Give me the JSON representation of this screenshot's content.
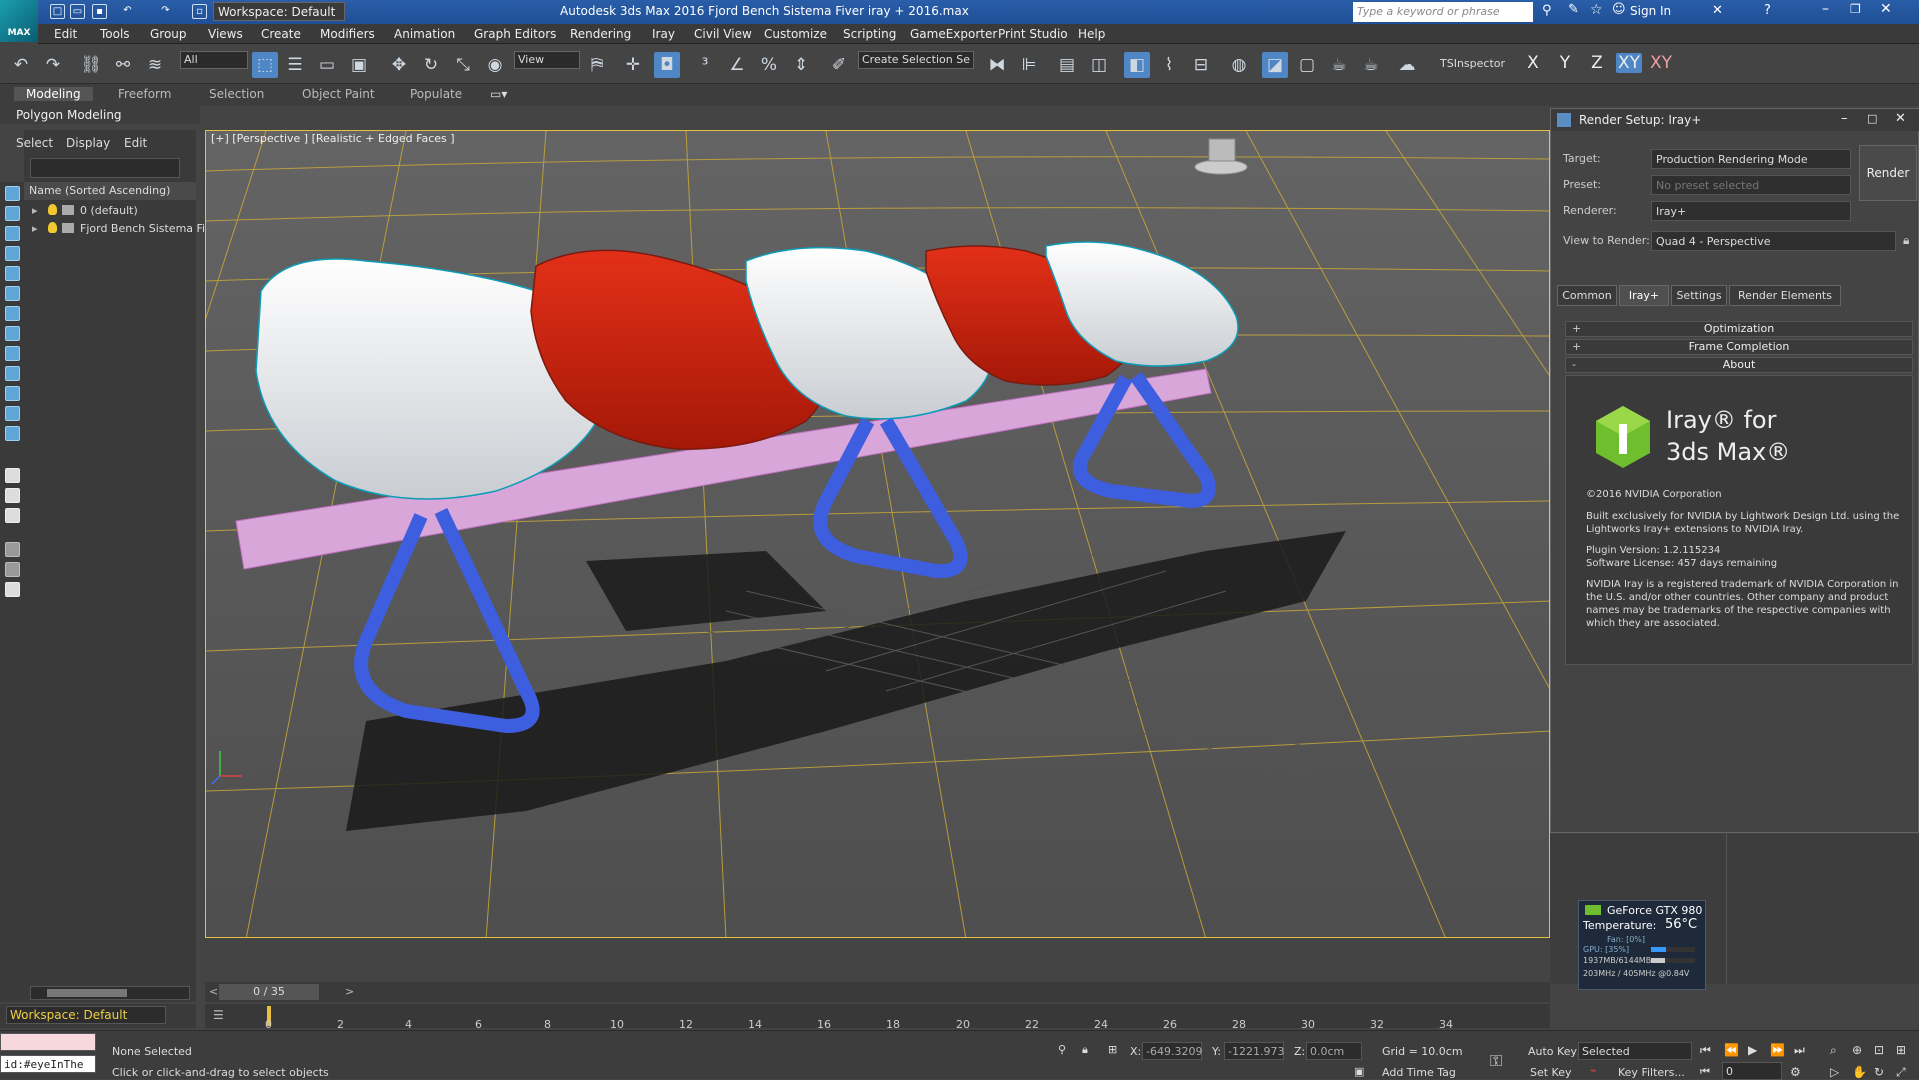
{
  "titlebar": {
    "app_title": "Autodesk 3ds Max 2016    Fjord Bench Sistema Fiver iray + 2016.max",
    "workspace": "Workspace: Default",
    "search_placeholder": "Type a keyword or phrase",
    "sign_in": "Sign In",
    "logo_text": "MAX"
  },
  "menubar": [
    "Edit",
    "Tools",
    "Group",
    "Views",
    "Create",
    "Modifiers",
    "Animation",
    "Graph Editors",
    "Rendering",
    "Iray",
    "Civil View",
    "Customize",
    "Scripting",
    "GameExporter",
    "Print Studio",
    "Help"
  ],
  "toolbar": {
    "selection_filter": "All",
    "reference_coord": "View",
    "named_selection": "Create Selection Se",
    "ts_inspector": "TSInspector",
    "axes": [
      "X",
      "Y",
      "Z",
      "XY",
      "XY"
    ]
  },
  "ribbon": {
    "tabs": [
      "Modeling",
      "Freeform",
      "Selection",
      "Object Paint",
      "Populate"
    ],
    "panel": "Polygon Modeling"
  },
  "explorer": {
    "menu": [
      "Select",
      "Display",
      "Edit"
    ],
    "column_header": "Name (Sorted Ascending)",
    "rows": [
      "0 (default)",
      "Fjord Bench Sistema Fiv"
    ],
    "workspace": "Workspace: Default"
  },
  "viewport": {
    "label": "[+] [Perspective ] [Realistic + Edged Faces ]"
  },
  "render_setup": {
    "title": "Render Setup: Iray+",
    "target_label": "Target:",
    "target_value": "Production Rendering Mode",
    "preset_label": "Preset:",
    "preset_value": "No preset selected",
    "renderer_label": "Renderer:",
    "renderer_value": "Iray+",
    "view_label": "View to Render:",
    "view_value": "Quad 4 - Perspective",
    "render_button": "Render",
    "tabs": [
      "Common",
      "Iray+",
      "Settings",
      "Render Elements"
    ],
    "rollouts": [
      {
        "sign": "+",
        "label": "Optimization"
      },
      {
        "sign": "+",
        "label": "Frame Completion"
      },
      {
        "sign": "-",
        "label": "About"
      }
    ],
    "about": {
      "product_line1": "Iray® for",
      "product_line2": "3ds Max®",
      "copyright": "©2016 NVIDIA Corporation",
      "built": "Built exclusively for NVIDIA by Lightwork Design Ltd. using the Lightworks Iray+ extensions to NVIDIA Iray.",
      "version": "Plugin Version: 1.2.115234",
      "license": "Software License: 457 days remaining",
      "trademark": "NVIDIA Iray is a registered trademark of NVIDIA Corporation in the U.S. and/or other countries. Other company and product names may be trademarks of the respective companies with which they are associated."
    }
  },
  "gpu": {
    "name": "GeForce GTX 980",
    "temp_label": "Temperature:",
    "temp_value": "56°C",
    "fan": "Fan: [0%]",
    "gpu_load": "GPU: [35%]",
    "memory": "1937MB/6144MB",
    "clock": "203MHz / 405MHz @0.84V"
  },
  "timeline": {
    "frame": "0 / 35",
    "ticks": [
      "0",
      "2",
      "4",
      "6",
      "8",
      "10",
      "12",
      "14",
      "16",
      "18",
      "20",
      "22",
      "24",
      "26",
      "28",
      "30",
      "32",
      "34"
    ]
  },
  "status": {
    "maxscript": "id:#eyeInThe",
    "selection": "None Selected",
    "prompt": "Click or click-and-drag to select objects",
    "x_label": "X:",
    "x_value": "-649.3209",
    "y_label": "Y:",
    "y_value": "-1221.973",
    "z_label": "Z:",
    "z_value": "0.0cm",
    "grid": "Grid = 10.0cm",
    "add_time_tag": "Add Time Tag",
    "auto_key": "Auto Key",
    "set_key": "Set Key",
    "key_mode": "Selected",
    "key_filters": "Key Filters...",
    "current_frame": "0"
  }
}
